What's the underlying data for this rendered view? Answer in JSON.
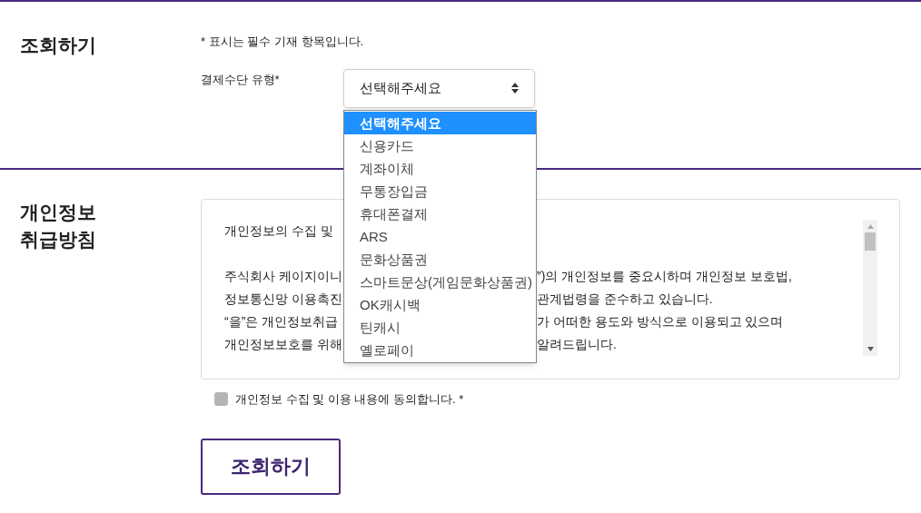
{
  "inquiry_section": {
    "heading": "조회하기",
    "required_note": "* 표시는 필수 기재 항목입니다.",
    "field_label": "결제수단 유형*",
    "select": {
      "value": "선택해주세요",
      "expanded": true,
      "options": [
        {
          "label": "선택해주세요",
          "selected": true
        },
        {
          "label": "신용카드",
          "selected": false
        },
        {
          "label": "계좌이체",
          "selected": false
        },
        {
          "label": "무통장입금",
          "selected": false
        },
        {
          "label": "휴대폰결제",
          "selected": false
        },
        {
          "label": "ARS",
          "selected": false
        },
        {
          "label": "문화상품권",
          "selected": false
        },
        {
          "label": "스마트문상(게임문화상품권)",
          "selected": false
        },
        {
          "label": "OK캐시백",
          "selected": false
        },
        {
          "label": "틴캐시",
          "selected": false
        },
        {
          "label": "옐로페이",
          "selected": false
        }
      ]
    }
  },
  "privacy_section": {
    "heading": "개인정보\n취급방침",
    "policy_paragraphs": [
      {
        "lines": [
          {
            "left": "개인정보의 수집 및"
          }
        ]
      },
      {
        "lines": [
          {
            "left": "주식회사 케이지이니",
            "right": "”)의 개인정보를 중요시하며 개인정보 보호법,"
          },
          {
            "left": "정보통신망 이용촉진",
            "right": "관계법령을 준수하고 있습니다."
          },
          {
            "left": "“을”은 개인정보취급",
            "right": "가 어떠한 용도와 방식으로 이용되고 있으며"
          },
          {
            "left": "개인정보보호를 위해",
            "right": "알려드립니다."
          }
        ]
      }
    ],
    "consent": {
      "label": "개인정보 수집 및 이용 내용에 동의합니다. *",
      "checked": false
    }
  },
  "submit_button": "조회하기"
}
